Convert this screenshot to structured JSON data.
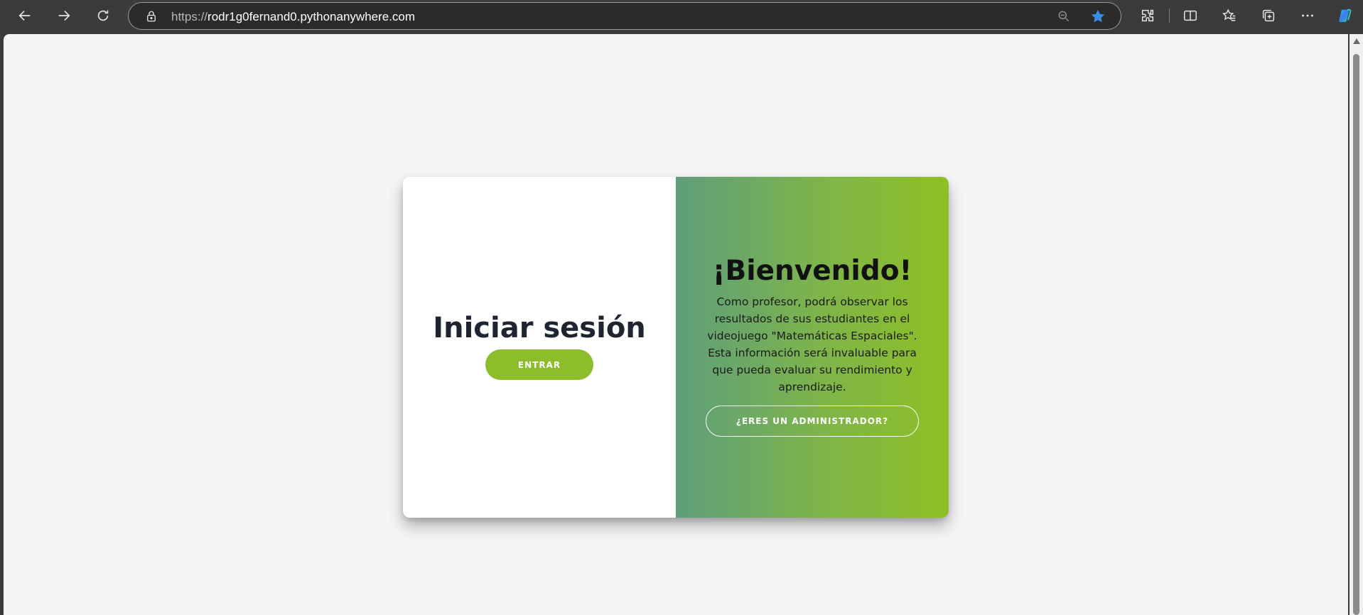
{
  "browser": {
    "url_scheme": "https://",
    "url_host": "rodr1g0fernand0.pythonanywhere.com",
    "icons": [
      "back-icon",
      "forward-icon",
      "refresh-icon",
      "lock-icon",
      "zoom-out-icon",
      "favorite-star-icon",
      "extensions-icon",
      "split-screen-icon",
      "favorites-icon",
      "collections-icon",
      "more-icon",
      "copilot-icon"
    ],
    "star_color": "#3a8ee6"
  },
  "login": {
    "title": "Iniciar sesión",
    "enter_label": "ENTRAR"
  },
  "welcome_panel": {
    "heading": "¡Bienvenido!",
    "description": "Como profesor, podrá observar los resultados de sus estudiantes en el videojuego \"Matemáticas Espaciales\". Esta información será invaluable para que pueda evaluar su rendimiento y aprendizaje.",
    "admin_label": "¿ERES UN ADMINISTRADOR?"
  },
  "colors": {
    "accent_green": "#8cbd2a",
    "gradient_start": "#5e9e7c",
    "gradient_end": "#8fbf24",
    "title_text": "#1e2530"
  }
}
